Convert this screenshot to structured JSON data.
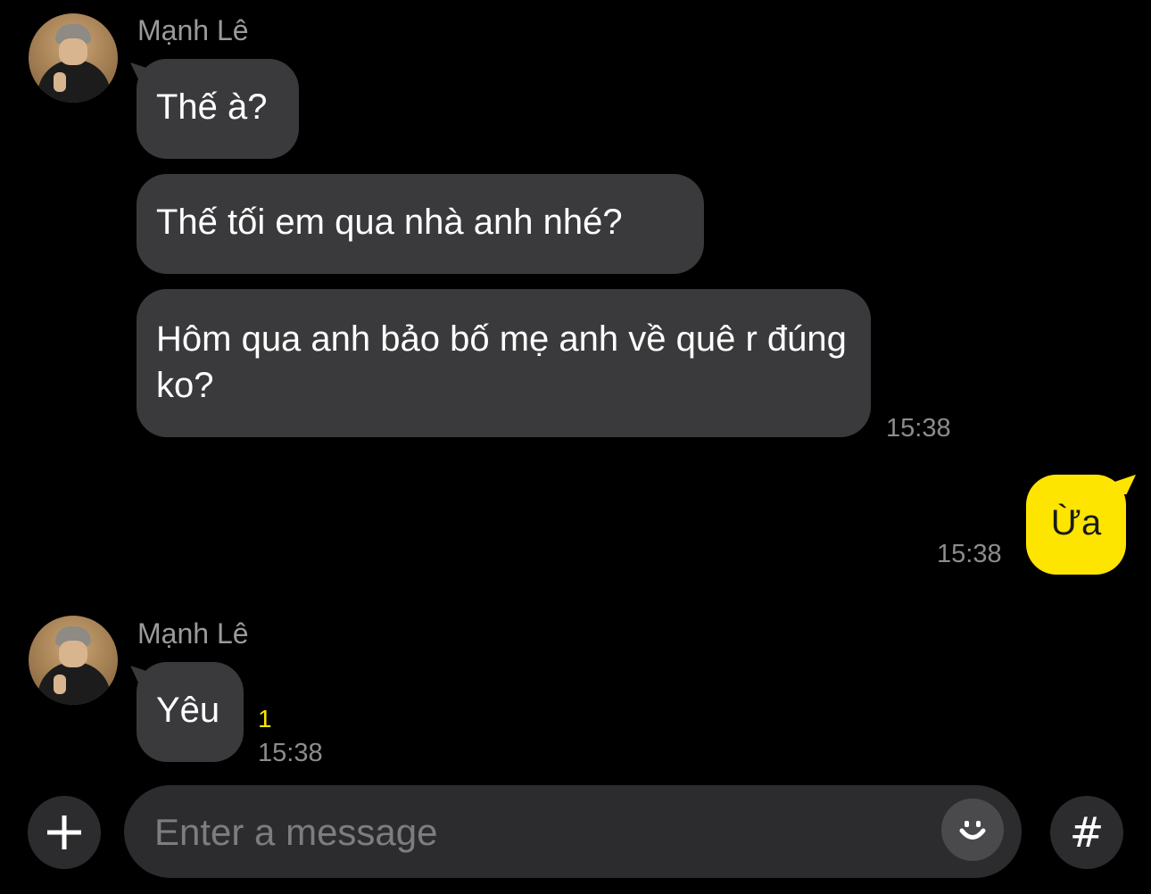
{
  "theme": {
    "background": "#000000",
    "incoming_bubble": "#3a3a3c",
    "outgoing_bubble": "#fee500",
    "unread_color": "#fee500"
  },
  "groups": [
    {
      "sender": "Mạnh Lê",
      "messages": [
        "Thế à?",
        "Thế tối em qua nhà anh nhé?",
        "Hôm qua anh bảo bố mẹ anh về quê r đúng ko?"
      ],
      "time": "15:38"
    },
    {
      "sender": "me",
      "messages": [
        "Ừa"
      ],
      "time": "15:38"
    },
    {
      "sender": "Mạnh Lê",
      "messages": [
        "Yêu"
      ],
      "unread_count": "1",
      "time": "15:38"
    }
  ],
  "composer": {
    "add_icon": "plus-icon",
    "placeholder": "Enter a message",
    "emoji_icon": "smile-emoticon-icon",
    "hashtag_label": "#"
  }
}
